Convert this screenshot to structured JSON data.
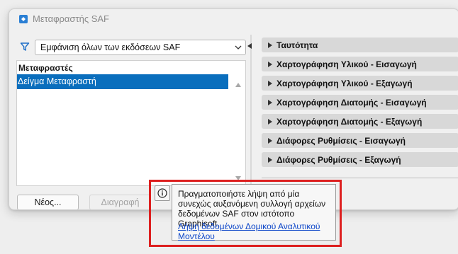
{
  "window": {
    "title": "Μεταφραστής SAF",
    "icon": "app-icon"
  },
  "filter": {
    "icon": "filter-icon",
    "selected": "Εμφάνιση όλων των εκδόσεων SAF"
  },
  "translators": {
    "header": "Μεταφραστές",
    "items": [
      {
        "label": "Δείγμα Μεταφραστή",
        "selected": true
      }
    ]
  },
  "buttons": {
    "new": "Νέος...",
    "delete": "Διαγραφή"
  },
  "sections": [
    {
      "label": "Ταυτότητα"
    },
    {
      "label": "Χαρτογράφηση Υλικού - Εισαγωγή"
    },
    {
      "label": "Χαρτογράφηση Υλικού - Εξαγωγή"
    },
    {
      "label": "Χαρτογράφηση Διατομής - Εισαγωγή"
    },
    {
      "label": "Χαρτογράφηση Διατομής - Εξαγωγή"
    },
    {
      "label": "Διάφορες Ρυθμίσεις - Εισαγωγή"
    },
    {
      "label": "Διάφορες Ρυθμίσεις - Εξαγωγή"
    }
  ],
  "tooltip": {
    "text": "Πραγματοποιήστε λήψη από μία συνεχώς αυξανόμενη συλλογή αρχείων δεδομένων SAF στον ιστότοπο Graphisoft.",
    "link": "Λήψη δεδομένων Δομικού Αναλυτικού Μοντέλου"
  },
  "colors": {
    "selection": "#0a6ebd",
    "highlight": "#dd1f1f",
    "link": "#0b45c8"
  }
}
